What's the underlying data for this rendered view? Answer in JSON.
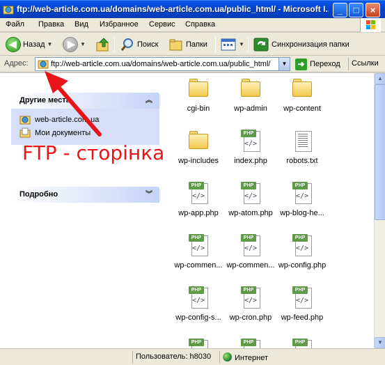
{
  "window": {
    "title": "ftp://web-article.com.ua/domains/web-article.com.ua/public_html/ - Microsoft I..."
  },
  "menu": [
    "Файл",
    "Правка",
    "Вид",
    "Избранное",
    "Сервис",
    "Справка"
  ],
  "toolbar": {
    "back": "Назад",
    "search": "Поиск",
    "folders": "Папки",
    "sync": "Синхронизация папки"
  },
  "address": {
    "label": "Адрес:",
    "value": "ftp://web-article.com.ua/domains/web-article.com.ua/public_html/",
    "go": "Переход",
    "links": "Ссылки"
  },
  "other_places": {
    "title": "Другие места",
    "items": [
      "web-article.com.ua",
      "Мои документы"
    ]
  },
  "details": {
    "title": "Подробно"
  },
  "annotation": {
    "text": "FTP - сторінка",
    "color": "#e8141a"
  },
  "files": [
    {
      "name": "cgi-bin",
      "kind": "folder"
    },
    {
      "name": "wp-admin",
      "kind": "folder"
    },
    {
      "name": "wp-content",
      "kind": "folder"
    },
    {
      "name": "wp-includes",
      "kind": "folder"
    },
    {
      "name": "index.php",
      "kind": "php"
    },
    {
      "name": "robots.txt",
      "kind": "txt"
    },
    {
      "name": "wp-app.php",
      "kind": "php"
    },
    {
      "name": "wp-atom.php",
      "kind": "php"
    },
    {
      "name": "wp-blog-he...",
      "kind": "php"
    },
    {
      "name": "wp-commen...",
      "kind": "php"
    },
    {
      "name": "wp-commen...",
      "kind": "php"
    },
    {
      "name": "wp-config.php",
      "kind": "php"
    },
    {
      "name": "wp-config-s...",
      "kind": "php"
    },
    {
      "name": "wp-cron.php",
      "kind": "php"
    },
    {
      "name": "wp-feed.php",
      "kind": "php"
    },
    {
      "name": "",
      "kind": "php"
    },
    {
      "name": "",
      "kind": "php"
    },
    {
      "name": "",
      "kind": "php"
    }
  ],
  "status": {
    "user": "Пользователь: h8030",
    "zone": "Интернет"
  },
  "icons": {
    "php_tag": "PHP",
    "code": "</>"
  }
}
